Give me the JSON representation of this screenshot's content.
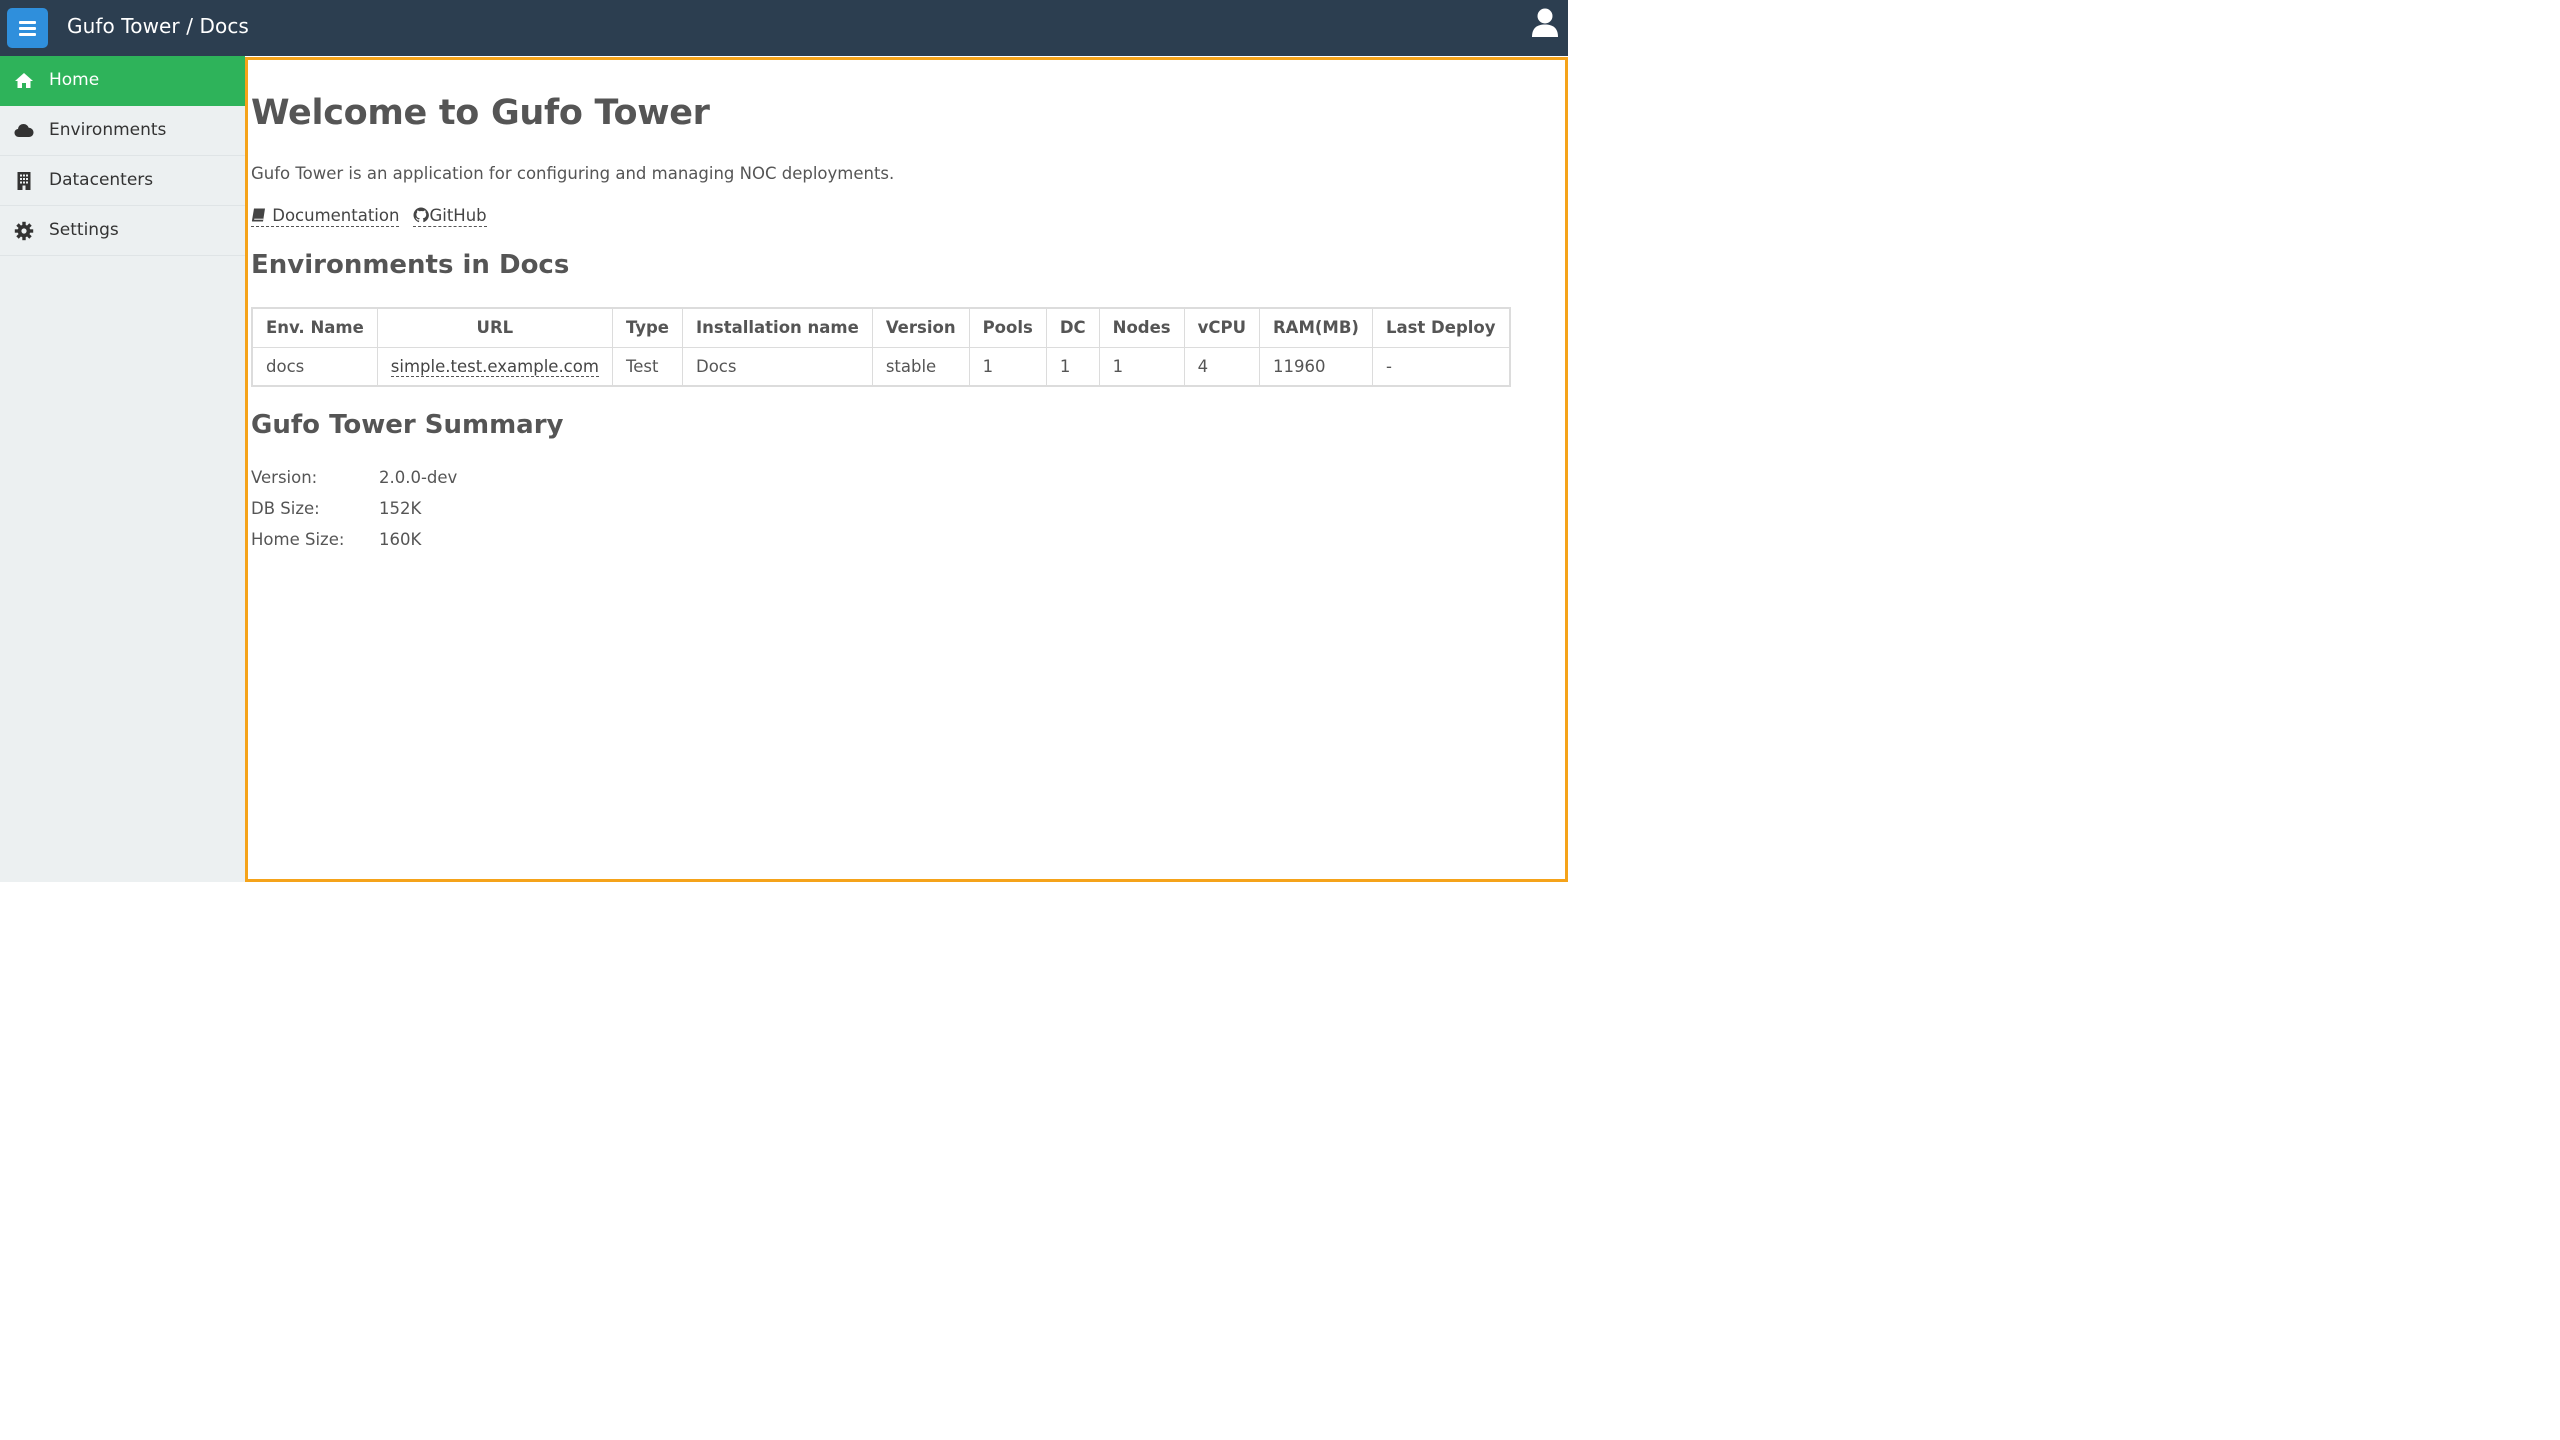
{
  "header": {
    "title": "Gufo Tower / Docs",
    "menu_icon": "hamburger-icon",
    "user_icon": "user-icon",
    "bg_color": "#2c3e50",
    "menu_button_color": "#2f8fdc"
  },
  "sidebar": {
    "items": [
      {
        "label": "Home",
        "icon": "home-icon",
        "active": true
      },
      {
        "label": "Environments",
        "icon": "cloud-icon",
        "active": false
      },
      {
        "label": "Datacenters",
        "icon": "building-icon",
        "active": false
      },
      {
        "label": "Settings",
        "icon": "gear-icon",
        "active": false
      }
    ],
    "active_color": "#2eb35a"
  },
  "main": {
    "border_color": "#f5a31a",
    "heading": "Welcome to Gufo Tower",
    "description": "Gufo Tower is an application for configuring and managing NOC deployments.",
    "links": [
      {
        "label": "Documentation",
        "icon": "book-icon"
      },
      {
        "label": "GitHub",
        "icon": "github-icon"
      }
    ],
    "environments_heading": "Environments in Docs",
    "table": {
      "columns": [
        "Env. Name",
        "URL",
        "Type",
        "Installation name",
        "Version",
        "Pools",
        "DC",
        "Nodes",
        "vCPU",
        "RAM(MB)",
        "Last Deploy"
      ],
      "rows": [
        [
          "docs",
          "simple.test.example.com",
          "Test",
          "Docs",
          "stable",
          "1",
          "1",
          "1",
          "4",
          "11960",
          "-"
        ]
      ]
    },
    "summary_heading": "Gufo Tower Summary",
    "summary": [
      {
        "key": "Version:",
        "value": "2.0.0-dev"
      },
      {
        "key": "DB Size:",
        "value": "152K"
      },
      {
        "key": "Home Size:",
        "value": "160K"
      }
    ]
  }
}
